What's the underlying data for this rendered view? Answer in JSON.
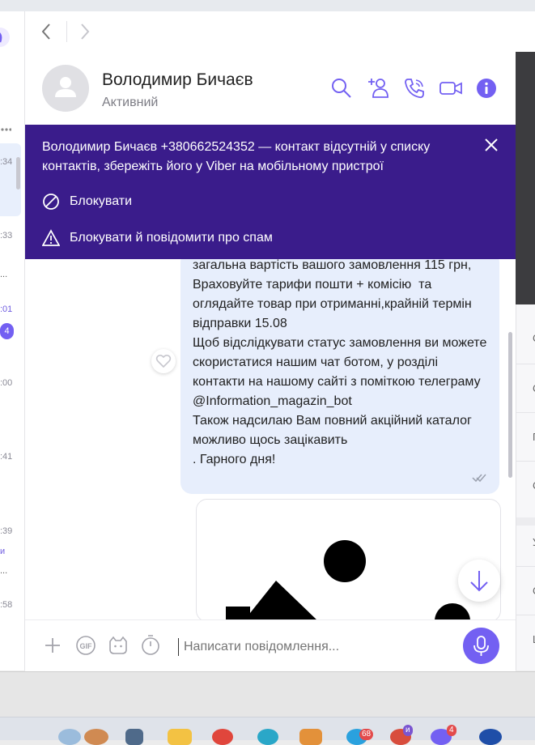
{
  "contact": {
    "name": "Володимир Бичаєв",
    "status": "Активний"
  },
  "banner": {
    "text": "Володимир Бичаєв +380662524352 — контакт відсутній у списку контактів, збережіть його у Viber на мобільному пристрої",
    "block_label": "Блокувати",
    "block_spam_label": "Блокувати й повідомити про спам"
  },
  "message": {
    "text": "загальна вартість вашого замовлення 115 грн, Враховуйте тарифи пошти + комісію  та оглядайте товар при отриманні,крайній термін відправки 15.08\nЩоб відслідкувати статус замовлення ви можете скористатися нашим чат ботом, у розділі контакти на нашому сайті з поміткою телеграму @Information_magazin_bot\nТакож надсилаю Вам повний акційний каталог можливо щось зацікавить\n. Гарного дня!"
  },
  "composer": {
    "placeholder": "Написати повідомлення..."
  },
  "chat_list": {
    "times": [
      ":34",
      ":33",
      ":01",
      ":00",
      ":41",
      ":39",
      ":58"
    ],
    "unread_badge": "4",
    "preview_fragments": [
      "...",
      "...",
      "и"
    ]
  },
  "right_panel": {
    "letters": [
      "С",
      "С",
      "П",
      "С",
      "У",
      "С",
      "Ш"
    ]
  },
  "taskbar": {
    "badges": [
      "68",
      "и",
      "4"
    ]
  },
  "colors": {
    "accent": "#7360f2",
    "banner": "#3a1c8b",
    "bubble": "#e7eefc"
  }
}
